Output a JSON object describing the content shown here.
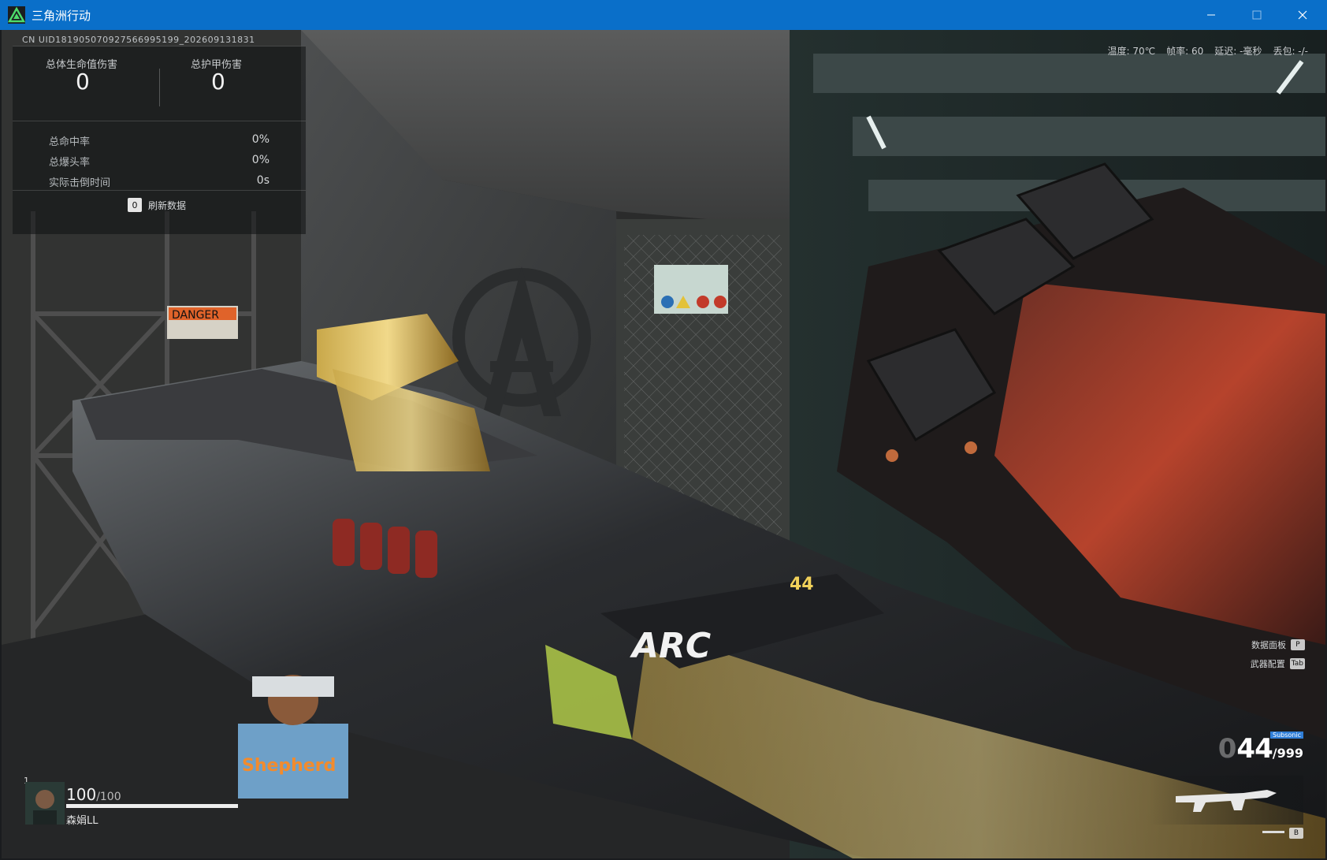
{
  "window": {
    "title": "三角洲行动",
    "controls": {
      "minimize": "—",
      "maximize": "☐",
      "close": "✕"
    }
  },
  "hud": {
    "uid": "CN UID181905070927566995199_202609131831",
    "stats": {
      "total_hp_damage_label": "总体生命值伤害",
      "total_hp_damage": "0",
      "total_armor_damage_label": "总护甲伤害",
      "total_armor_damage": "0",
      "rows": [
        {
          "label": "总命中率",
          "value": "0%"
        },
        {
          "label": "总爆头率",
          "value": "0%"
        },
        {
          "label": "实际击倒时间",
          "value": "0s"
        }
      ],
      "refresh_key": "0",
      "refresh_label": "刷新数据"
    },
    "perf": {
      "temp": "温度: 70℃",
      "fps": "帧率: 60",
      "latency": "延迟: -毫秒",
      "packet_loss": "丢包: -/-"
    },
    "player": {
      "squad_number": "1",
      "hp": "100",
      "hp_max": "/100",
      "hp_fraction": 1.0,
      "name": "森娟LL"
    },
    "hints": [
      {
        "label": "数据面板",
        "key": "P"
      },
      {
        "label": "武器配置",
        "key": "Tab"
      }
    ],
    "ammo": {
      "lead_zero": "0",
      "current": "44",
      "reserve": "/999",
      "type": "Subsonic"
    },
    "fire_mode_key": "B"
  },
  "scene": {
    "sign_text": "DANGER",
    "weapon_text": "ARC",
    "weapon_number": "44",
    "sticker_text": "Shepherd"
  },
  "colors": {
    "titlebar": "#0a6fc9",
    "ammo_badge": "#2f7ed8"
  }
}
